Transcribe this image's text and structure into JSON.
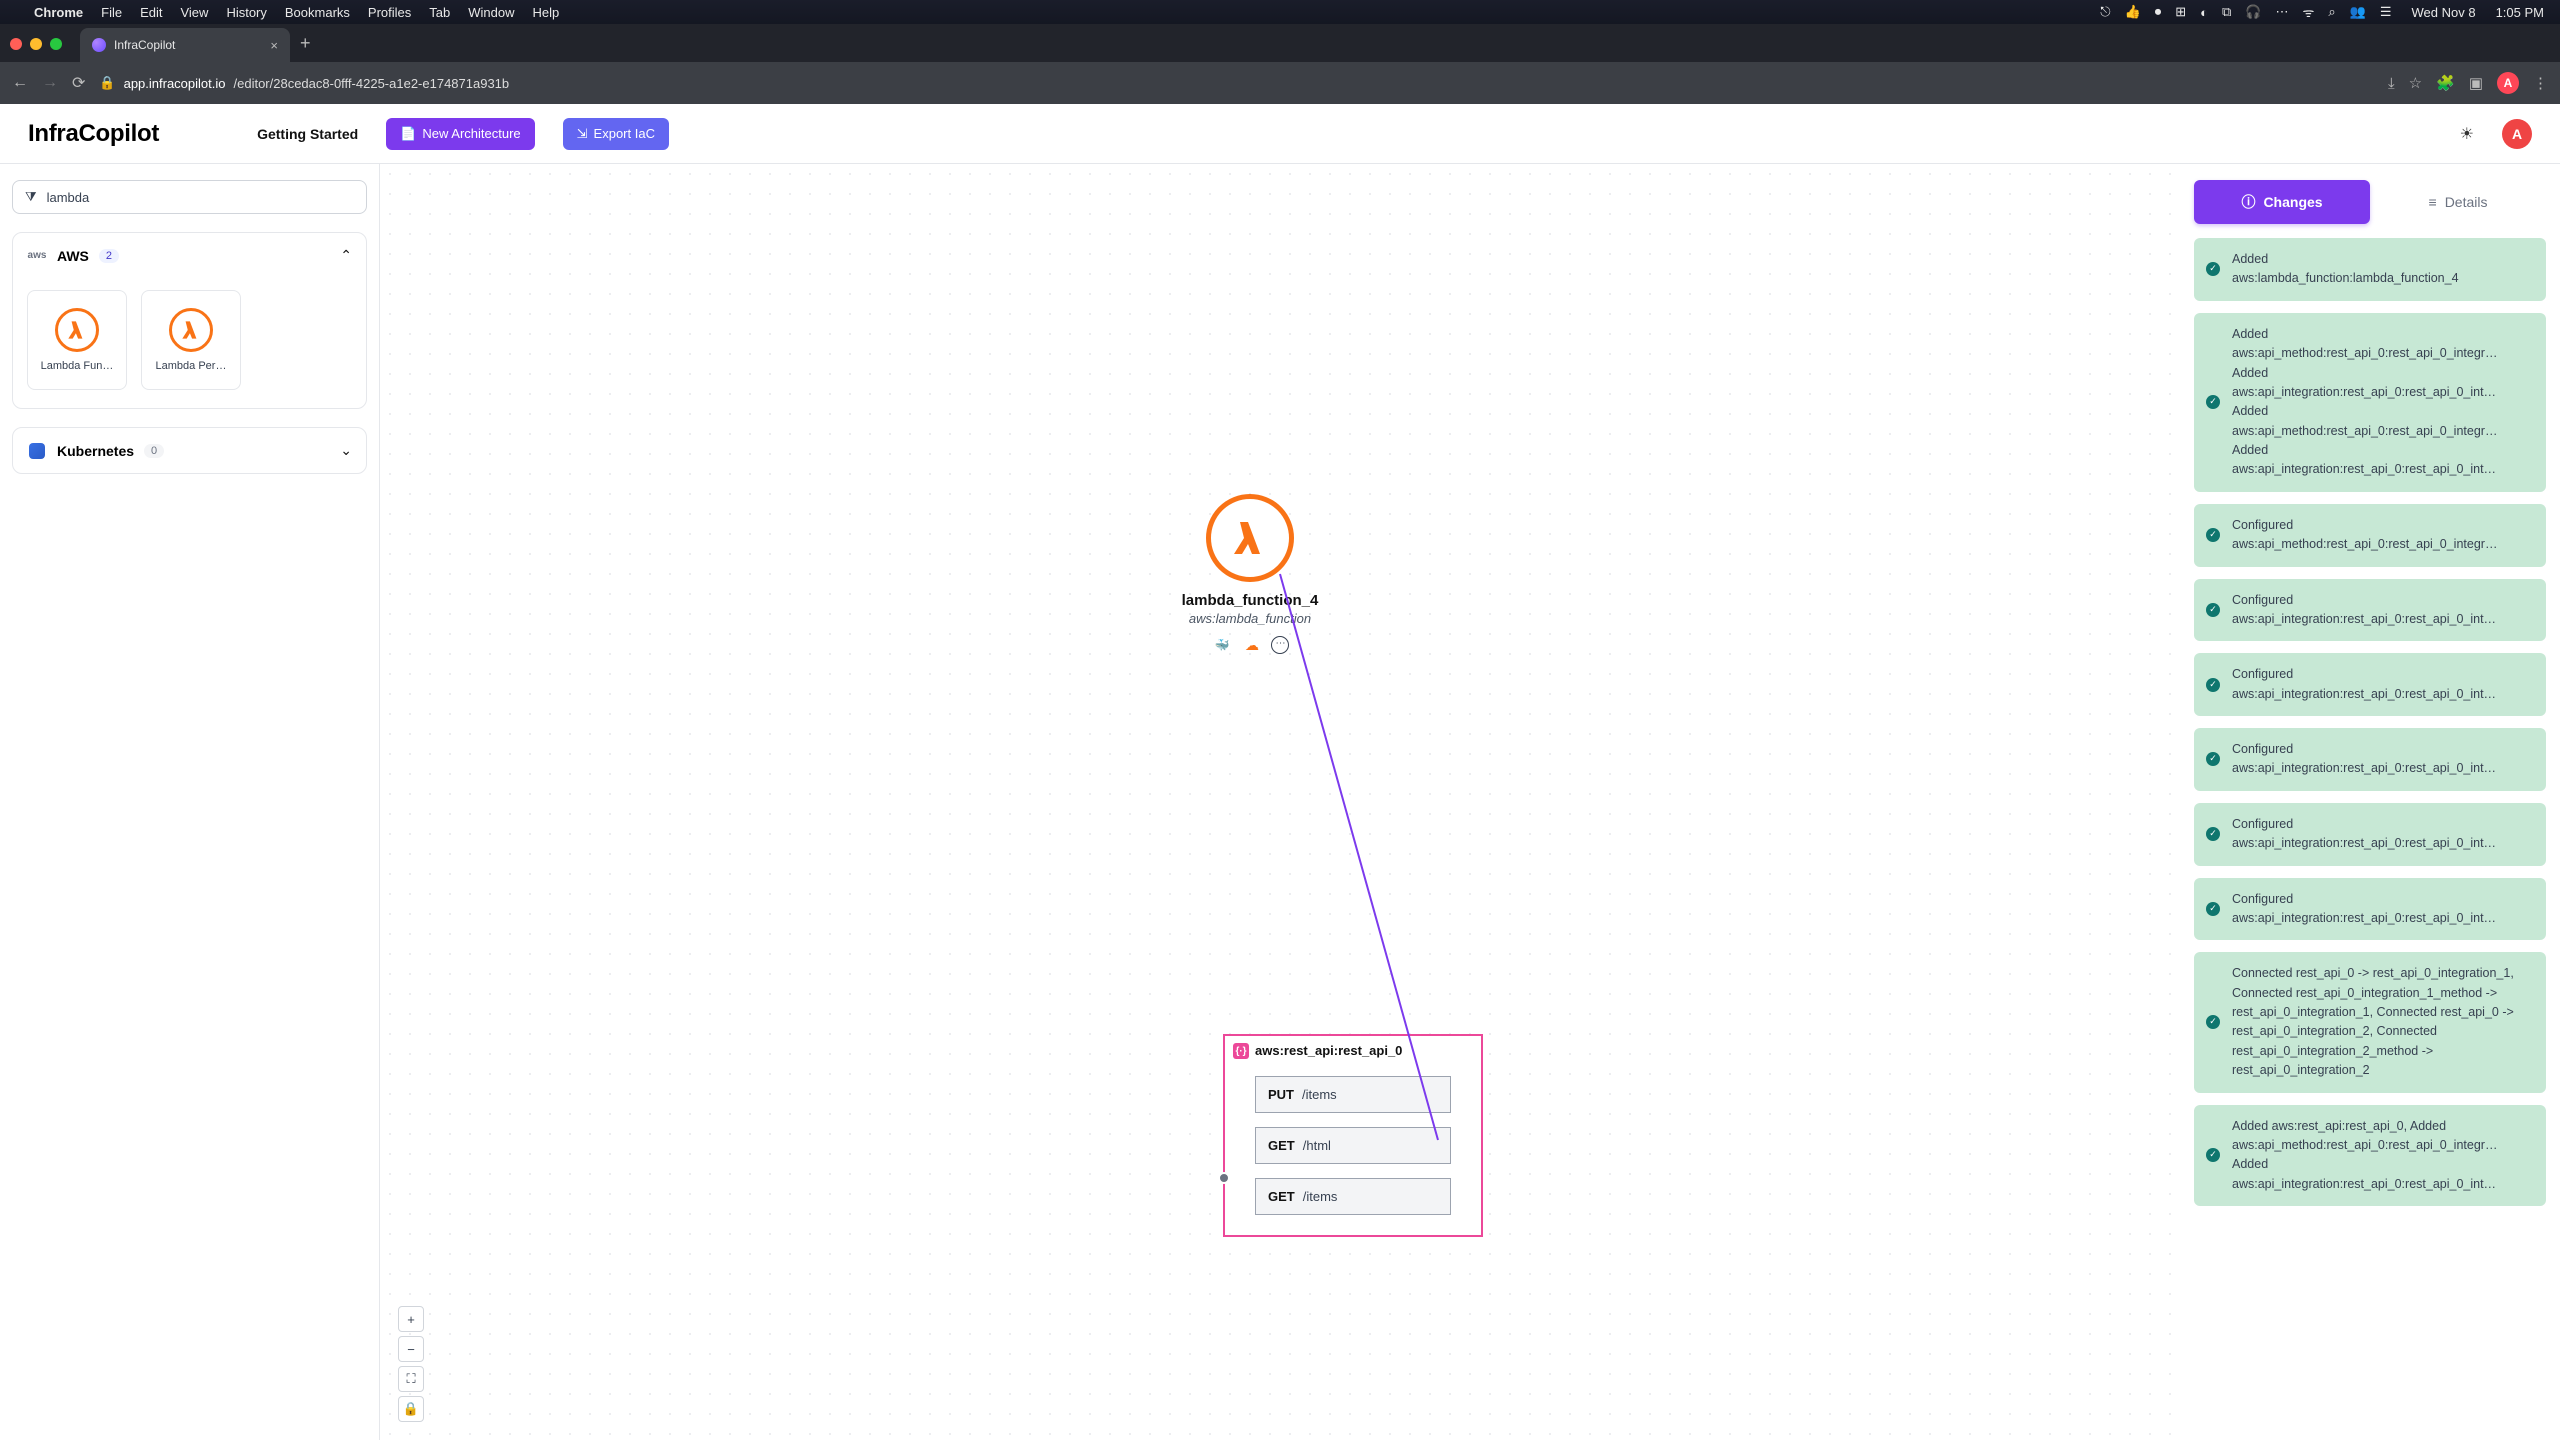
{
  "macos": {
    "app": "Chrome",
    "menus": [
      "File",
      "Edit",
      "View",
      "History",
      "Bookmarks",
      "Profiles",
      "Tab",
      "Window",
      "Help"
    ],
    "clock_day": "Wed Nov 8",
    "clock_time": "1:05 PM"
  },
  "browser": {
    "tab_title": "InfraCopilot",
    "url_host": "app.infracopilot.io",
    "url_path": "/editor/28cedac8-0fff-4225-a1e2-e174871a931b",
    "avatar_initial": "A"
  },
  "header": {
    "brand": "InfraCopilot",
    "getting_started": "Getting Started",
    "new_arch": "New Architecture",
    "export": "Export IaC",
    "avatar_initial": "A"
  },
  "sidebar": {
    "search_value": "lambda",
    "aws": {
      "label": "AWS",
      "count": "2",
      "expanded": true
    },
    "items": [
      {
        "label": "Lambda Fun…"
      },
      {
        "label": "Lambda Per…"
      }
    ],
    "k8s": {
      "label": "Kubernetes",
      "count": "0",
      "expanded": false
    }
  },
  "canvas": {
    "lambda": {
      "title": "lambda_function_4",
      "subtitle": "aws:lambda_function"
    },
    "api": {
      "title": "aws:rest_api:rest_api_0",
      "routes": [
        {
          "method": "PUT",
          "path": "/items"
        },
        {
          "method": "GET",
          "path": "/html"
        },
        {
          "method": "GET",
          "path": "/items"
        }
      ]
    }
  },
  "panel": {
    "tab_changes": "Changes",
    "tab_details": "Details",
    "changes": [
      {
        "lines": [
          "Added",
          "aws:lambda_function:lambda_function_4"
        ]
      },
      {
        "lines": [
          "Added",
          "aws:api_method:rest_api_0:rest_api_0_integr…",
          "Added",
          "aws:api_integration:rest_api_0:rest_api_0_int…",
          "Added",
          "aws:api_method:rest_api_0:rest_api_0_integr…",
          "Added",
          "aws:api_integration:rest_api_0:rest_api_0_int…"
        ]
      },
      {
        "lines": [
          "Configured",
          "aws:api_method:rest_api_0:rest_api_0_integr…"
        ]
      },
      {
        "lines": [
          "Configured",
          "aws:api_integration:rest_api_0:rest_api_0_int…"
        ]
      },
      {
        "lines": [
          "Configured",
          "aws:api_integration:rest_api_0:rest_api_0_int…"
        ]
      },
      {
        "lines": [
          "Configured",
          "aws:api_integration:rest_api_0:rest_api_0_int…"
        ]
      },
      {
        "lines": [
          "Configured",
          "aws:api_integration:rest_api_0:rest_api_0_int…"
        ]
      },
      {
        "lines": [
          "Configured",
          "aws:api_integration:rest_api_0:rest_api_0_int…"
        ]
      },
      {
        "lines": [
          "Connected rest_api_0 -> rest_api_0_integration_1, Connected rest_api_0_integration_1_method -> rest_api_0_integration_1, Connected rest_api_0 -> rest_api_0_integration_2, Connected rest_api_0_integration_2_method -> rest_api_0_integration_2"
        ]
      },
      {
        "lines": [
          "Added aws:rest_api:rest_api_0, Added",
          "aws:api_method:rest_api_0:rest_api_0_integr…",
          "Added",
          "aws:api_integration:rest_api_0:rest_api_0_int…"
        ]
      }
    ]
  }
}
